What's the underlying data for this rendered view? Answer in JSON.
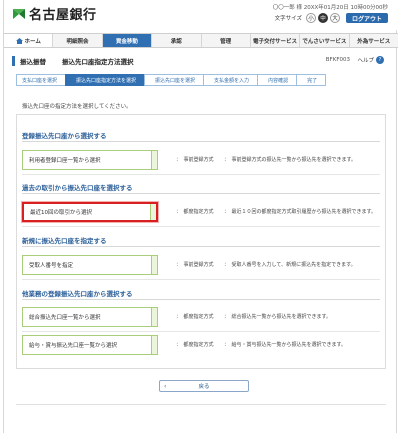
{
  "header": {
    "bank_name": "名古屋銀行",
    "user_line": "〇〇一郎 様  20XX年01月20日 10時00分00秒",
    "font_size_label": "文字サイズ",
    "font_sizes": [
      "小",
      "中",
      "大"
    ],
    "logout_label": "ログアウト"
  },
  "nav": {
    "items": [
      "ホーム",
      "明細照会",
      "資金移動",
      "承認",
      "管理",
      "電子交付サービス",
      "でんさいサービス",
      "外為サービス"
    ]
  },
  "title": {
    "main": "振込振替",
    "sub": "振込先口座指定方法選択",
    "screen_id": "BFKF003",
    "help_label": "ヘルプ",
    "help_icon": "?"
  },
  "steps": [
    "支払口座を選択",
    "振込先口座指定方法を選択",
    "振込先口座を選択",
    "支払金額を入力",
    "内容確認",
    "完了"
  ],
  "intro_text": "振込先口座の指定方法を選択してください。",
  "sections": [
    {
      "title": "登録振込先口座から選択する",
      "rows": [
        {
          "label": "利用者登録口座一覧から選択",
          "method": "：　事前登録方式",
          "desc": "：　事前登録方式の振込先一覧から振込先を選択できます。"
        }
      ]
    },
    {
      "title": "過去の取引から振込先口座を選択する",
      "rows": [
        {
          "label": "最近10回の取引から選択",
          "method": "：　都度指定方式",
          "desc": "：　最近１０回の都度指定方式取引履歴から振込先を選択できます。"
        }
      ]
    },
    {
      "title": "新規に振込先口座を指定する",
      "rows": [
        {
          "label": "受取人番号を指定",
          "method": "：　事前登録方式",
          "desc": "：　受取人番号を入力して、新規に振込先を指定できます。"
        }
      ]
    },
    {
      "title": "他業務の登録振込先口座から選択する",
      "rows": [
        {
          "label": "総合振込先口座一覧から選択",
          "method": "：　都度指定方式",
          "desc": "：　総合振込先一覧から振込先を選択できます。"
        },
        {
          "label": "給与・賞与振込先口座一覧から選択",
          "method": "：　都度指定方式",
          "desc": "：　給与・賞与振込先一覧から振込先を選択できます。"
        }
      ]
    }
  ],
  "back_label": "戻る",
  "back_icon": "‹",
  "colors": {
    "accent": "#2f6fb2",
    "highlight": "#d92020",
    "option_border": "#a9cd7b"
  }
}
